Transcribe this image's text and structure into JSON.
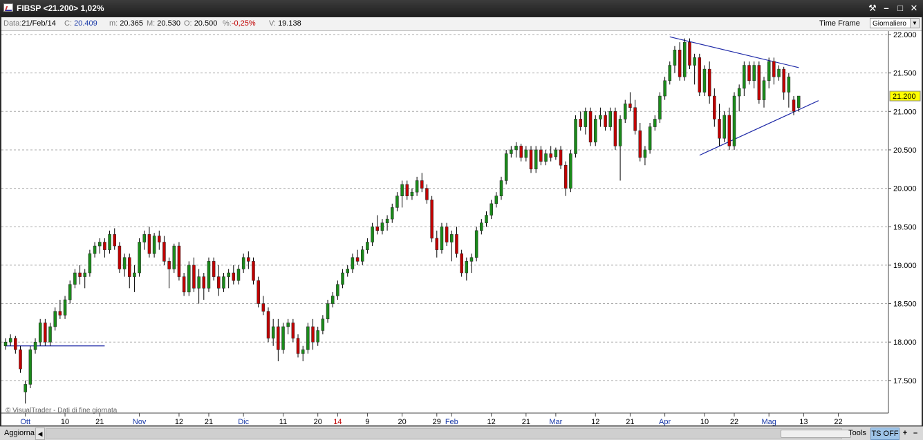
{
  "window": {
    "title": "FIBSP <21.200> 1,02%",
    "controls": [
      "tools-icon",
      "minimize-icon",
      "maximize-icon",
      "close-icon"
    ]
  },
  "info": {
    "data_label": "Data:",
    "data_value": "21/Feb/14",
    "close_label": "C:",
    "close_value": "20.409",
    "min_label": "m:",
    "min_value": "20.365",
    "max_label": "M:",
    "max_value": "20.530",
    "open_label": "O:",
    "open_value": "20.500",
    "pct_label": "%:",
    "pct_value": "-0,25%",
    "vol_label": "V:",
    "vol_value": "19.138",
    "timeframe_label": "Time Frame",
    "timeframe_value": "Giornaliero"
  },
  "colors": {
    "up": "#1a8a1a",
    "down": "#c00000",
    "wick": "#000000",
    "trendline": "#1f2aa8",
    "last_price_bg": "#ffff00",
    "grid": "#aaaaaa"
  },
  "chart_data": {
    "type": "candlestick",
    "symbol": "FIBSP",
    "last_price": "21.200",
    "y_ticks": [
      "22.000",
      "21.500",
      "21.000",
      "20.500",
      "20.000",
      "19.500",
      "19.000",
      "18.500",
      "18.000",
      "17.500"
    ],
    "ylim": [
      17.25,
      22.1
    ],
    "x_ticks": [
      {
        "label": "Ott",
        "i": 4,
        "month": true
      },
      {
        "label": "10",
        "i": 12
      },
      {
        "label": "21",
        "i": 19
      },
      {
        "label": "Nov",
        "i": 27,
        "month": true
      },
      {
        "label": "12",
        "i": 35
      },
      {
        "label": "21",
        "i": 41
      },
      {
        "label": "Dic",
        "i": 48,
        "month": true
      },
      {
        "label": "11",
        "i": 56
      },
      {
        "label": "20",
        "i": 63
      },
      {
        "label": "14",
        "i": 67,
        "red": true
      },
      {
        "label": "9",
        "i": 73
      },
      {
        "label": "20",
        "i": 80
      },
      {
        "label": "29",
        "i": 87
      },
      {
        "label": "Feb",
        "i": 90,
        "month": true
      },
      {
        "label": "12",
        "i": 98
      },
      {
        "label": "21",
        "i": 105
      },
      {
        "label": "Mar",
        "i": 111,
        "month": true
      },
      {
        "label": "12",
        "i": 119
      },
      {
        "label": "21",
        "i": 126
      },
      {
        "label": "Apr",
        "i": 133,
        "month": true
      },
      {
        "label": "10",
        "i": 141
      },
      {
        "label": "22",
        "i": 147
      },
      {
        "label": "Mag",
        "i": 154,
        "month": true
      },
      {
        "label": "13",
        "i": 161
      },
      {
        "label": "22",
        "i": 168
      }
    ],
    "candles": [
      [
        17.95,
        18.05,
        17.9,
        18.0
      ],
      [
        18.0,
        18.1,
        17.95,
        18.05
      ],
      [
        18.05,
        18.08,
        17.85,
        17.9
      ],
      [
        17.9,
        17.95,
        17.6,
        17.65
      ],
      [
        17.35,
        17.5,
        17.2,
        17.45
      ],
      [
        17.45,
        17.95,
        17.4,
        17.9
      ],
      [
        17.9,
        18.05,
        17.85,
        18.0
      ],
      [
        18.0,
        18.3,
        17.95,
        18.25
      ],
      [
        18.25,
        18.3,
        17.95,
        18.0
      ],
      [
        18.0,
        18.25,
        17.95,
        18.2
      ],
      [
        18.2,
        18.45,
        18.15,
        18.4
      ],
      [
        18.4,
        18.55,
        18.3,
        18.35
      ],
      [
        18.35,
        18.6,
        18.3,
        18.55
      ],
      [
        18.55,
        18.8,
        18.5,
        18.75
      ],
      [
        18.75,
        18.95,
        18.7,
        18.9
      ],
      [
        18.9,
        19.0,
        18.75,
        18.85
      ],
      [
        18.85,
        18.95,
        18.7,
        18.9
      ],
      [
        18.9,
        19.2,
        18.85,
        19.15
      ],
      [
        19.15,
        19.3,
        19.1,
        19.25
      ],
      [
        19.25,
        19.35,
        19.15,
        19.3
      ],
      [
        19.3,
        19.35,
        19.1,
        19.2
      ],
      [
        19.2,
        19.45,
        19.15,
        19.4
      ],
      [
        19.4,
        19.48,
        19.2,
        19.25
      ],
      [
        19.25,
        19.3,
        18.9,
        18.95
      ],
      [
        18.95,
        19.15,
        18.85,
        19.1
      ],
      [
        19.1,
        19.15,
        18.7,
        18.85
      ],
      [
        18.85,
        19.0,
        18.65,
        18.9
      ],
      [
        18.9,
        19.35,
        18.85,
        19.3
      ],
      [
        19.3,
        19.45,
        19.2,
        19.4
      ],
      [
        19.4,
        19.5,
        19.1,
        19.15
      ],
      [
        19.15,
        19.42,
        19.1,
        19.38
      ],
      [
        19.38,
        19.45,
        19.2,
        19.3
      ],
      [
        19.3,
        19.38,
        19.0,
        19.05
      ],
      [
        19.05,
        19.1,
        18.7,
        18.95
      ],
      [
        18.95,
        19.28,
        18.9,
        19.25
      ],
      [
        19.25,
        19.3,
        18.8,
        18.85
      ],
      [
        18.85,
        18.9,
        18.6,
        18.65
      ],
      [
        18.65,
        19.05,
        18.6,
        19.0
      ],
      [
        19.0,
        19.1,
        18.65,
        18.7
      ],
      [
        18.7,
        18.95,
        18.5,
        18.85
      ],
      [
        18.85,
        18.9,
        18.55,
        18.7
      ],
      [
        18.7,
        19.1,
        18.65,
        19.05
      ],
      [
        19.05,
        19.1,
        18.8,
        18.85
      ],
      [
        18.85,
        19.0,
        18.6,
        18.7
      ],
      [
        18.7,
        18.9,
        18.65,
        18.85
      ],
      [
        18.85,
        18.95,
        18.7,
        18.9
      ],
      [
        18.9,
        19.0,
        18.75,
        18.8
      ],
      [
        18.8,
        19.0,
        18.75,
        18.95
      ],
      [
        18.95,
        19.15,
        18.9,
        19.1
      ],
      [
        19.1,
        19.18,
        18.95,
        19.05
      ],
      [
        19.05,
        19.1,
        18.75,
        18.8
      ],
      [
        18.8,
        18.85,
        18.45,
        18.5
      ],
      [
        18.5,
        18.6,
        18.35,
        18.4
      ],
      [
        18.4,
        18.45,
        18.0,
        18.05
      ],
      [
        18.05,
        18.3,
        17.95,
        18.2
      ],
      [
        18.2,
        18.3,
        17.75,
        17.9
      ],
      [
        17.9,
        18.25,
        17.85,
        18.2
      ],
      [
        18.2,
        18.3,
        18.1,
        18.25
      ],
      [
        18.25,
        18.3,
        18.0,
        18.05
      ],
      [
        18.05,
        18.1,
        17.8,
        17.85
      ],
      [
        17.85,
        17.95,
        17.75,
        17.9
      ],
      [
        17.9,
        18.25,
        17.85,
        18.2
      ],
      [
        18.2,
        18.3,
        17.9,
        18.0
      ],
      [
        18.0,
        18.2,
        17.95,
        18.15
      ],
      [
        18.15,
        18.35,
        18.1,
        18.3
      ],
      [
        18.3,
        18.55,
        18.25,
        18.5
      ],
      [
        18.5,
        18.65,
        18.45,
        18.6
      ],
      [
        18.6,
        18.8,
        18.55,
        18.75
      ],
      [
        18.75,
        18.95,
        18.7,
        18.9
      ],
      [
        18.9,
        19.0,
        18.85,
        18.95
      ],
      [
        18.95,
        19.15,
        18.9,
        19.1
      ],
      [
        19.1,
        19.2,
        19.0,
        19.05
      ],
      [
        19.05,
        19.25,
        19.0,
        19.2
      ],
      [
        19.2,
        19.35,
        19.15,
        19.3
      ],
      [
        19.3,
        19.55,
        19.25,
        19.5
      ],
      [
        19.5,
        19.65,
        19.4,
        19.45
      ],
      [
        19.45,
        19.6,
        19.4,
        19.55
      ],
      [
        19.55,
        19.65,
        19.45,
        19.6
      ],
      [
        19.6,
        19.8,
        19.55,
        19.75
      ],
      [
        19.75,
        19.95,
        19.7,
        19.9
      ],
      [
        19.9,
        20.1,
        19.75,
        20.05
      ],
      [
        20.05,
        20.1,
        19.85,
        19.9
      ],
      [
        19.9,
        20.0,
        19.85,
        19.95
      ],
      [
        19.95,
        20.15,
        19.9,
        20.1
      ],
      [
        20.1,
        20.2,
        19.95,
        20.0
      ],
      [
        20.0,
        20.05,
        19.8,
        19.85
      ],
      [
        19.85,
        19.9,
        19.3,
        19.35
      ],
      [
        19.35,
        19.45,
        19.1,
        19.2
      ],
      [
        19.2,
        19.55,
        19.15,
        19.5
      ],
      [
        19.5,
        19.55,
        19.25,
        19.3
      ],
      [
        19.3,
        19.45,
        19.05,
        19.4
      ],
      [
        19.4,
        19.5,
        19.1,
        19.15
      ],
      [
        19.15,
        19.2,
        18.85,
        18.9
      ],
      [
        18.9,
        19.1,
        18.8,
        19.05
      ],
      [
        19.05,
        19.15,
        18.9,
        19.1
      ],
      [
        19.1,
        19.5,
        19.05,
        19.45
      ],
      [
        19.45,
        19.6,
        19.4,
        19.55
      ],
      [
        19.55,
        19.7,
        19.5,
        19.65
      ],
      [
        19.65,
        19.85,
        19.6,
        19.8
      ],
      [
        19.8,
        19.95,
        19.75,
        19.9
      ],
      [
        19.9,
        20.15,
        19.85,
        20.1
      ],
      [
        20.1,
        20.5,
        20.05,
        20.45
      ],
      [
        20.45,
        20.55,
        20.4,
        20.5
      ],
      [
        20.5,
        20.6,
        20.4,
        20.55
      ],
      [
        20.55,
        20.58,
        20.35,
        20.4
      ],
      [
        20.4,
        20.55,
        20.35,
        20.5
      ],
      [
        20.5,
        20.55,
        20.2,
        20.25
      ],
      [
        20.25,
        20.55,
        20.2,
        20.5
      ],
      [
        20.5,
        20.55,
        20.3,
        20.35
      ],
      [
        20.35,
        20.5,
        20.3,
        20.45
      ],
      [
        20.45,
        20.55,
        20.35,
        20.4
      ],
      [
        20.41,
        20.53,
        20.37,
        20.5
      ],
      [
        20.5,
        20.55,
        20.25,
        20.3
      ],
      [
        20.3,
        20.35,
        19.9,
        20.0
      ],
      [
        20.0,
        20.5,
        19.95,
        20.45
      ],
      [
        20.45,
        20.95,
        20.4,
        20.9
      ],
      [
        20.9,
        21.0,
        20.75,
        20.8
      ],
      [
        20.8,
        21.05,
        20.7,
        21.0
      ],
      [
        21.0,
        21.05,
        20.55,
        20.6
      ],
      [
        20.6,
        20.95,
        20.55,
        20.9
      ],
      [
        20.9,
        21.05,
        20.8,
        20.95
      ],
      [
        20.95,
        21.0,
        20.75,
        20.8
      ],
      [
        20.8,
        21.05,
        20.75,
        21.0
      ],
      [
        21.0,
        21.05,
        20.5,
        20.55
      ],
      [
        20.55,
        20.95,
        20.1,
        20.9
      ],
      [
        20.9,
        21.15,
        20.85,
        21.1
      ],
      [
        21.1,
        21.25,
        21.0,
        21.05
      ],
      [
        21.05,
        21.15,
        20.7,
        20.75
      ],
      [
        20.75,
        20.85,
        20.35,
        20.4
      ],
      [
        20.4,
        20.55,
        20.3,
        20.5
      ],
      [
        20.5,
        20.85,
        20.45,
        20.8
      ],
      [
        20.8,
        20.95,
        20.75,
        20.9
      ],
      [
        20.9,
        21.25,
        20.85,
        21.2
      ],
      [
        21.2,
        21.45,
        21.15,
        21.4
      ],
      [
        21.4,
        21.65,
        21.35,
        21.6
      ],
      [
        21.6,
        21.85,
        21.5,
        21.8
      ],
      [
        21.8,
        21.9,
        21.4,
        21.45
      ],
      [
        21.45,
        21.95,
        21.4,
        21.9
      ],
      [
        21.9,
        21.95,
        21.55,
        21.6
      ],
      [
        21.6,
        21.75,
        21.35,
        21.7
      ],
      [
        21.7,
        21.75,
        21.2,
        21.25
      ],
      [
        21.25,
        21.6,
        21.2,
        21.55
      ],
      [
        21.55,
        21.65,
        21.1,
        21.2
      ],
      [
        21.2,
        21.3,
        20.8,
        20.9
      ],
      [
        20.9,
        21.1,
        20.55,
        20.65
      ],
      [
        20.65,
        21.0,
        20.6,
        20.95
      ],
      [
        20.95,
        21.05,
        20.5,
        20.55
      ],
      [
        20.55,
        21.25,
        20.5,
        21.2
      ],
      [
        21.2,
        21.35,
        21.0,
        21.3
      ],
      [
        21.3,
        21.65,
        21.2,
        21.6
      ],
      [
        21.6,
        21.65,
        21.35,
        21.4
      ],
      [
        21.4,
        21.65,
        21.3,
        21.6
      ],
      [
        21.6,
        21.65,
        21.1,
        21.15
      ],
      [
        21.15,
        21.45,
        21.05,
        21.4
      ],
      [
        21.4,
        21.7,
        21.3,
        21.65
      ],
      [
        21.65,
        21.7,
        21.35,
        21.45
      ],
      [
        21.45,
        21.6,
        21.4,
        21.55
      ],
      [
        21.55,
        21.58,
        21.15,
        21.25
      ],
      [
        21.25,
        21.5,
        21.05,
        21.45
      ],
      [
        21.15,
        21.2,
        20.95,
        21.0
      ],
      [
        21.05,
        21.2,
        21.0,
        21.2
      ]
    ],
    "trendlines": [
      {
        "i1": 0,
        "v1": 17.95,
        "i2": 20,
        "v2": 17.95
      },
      {
        "i1": 134,
        "v1": 21.97,
        "i2": 160,
        "v2": 21.57
      },
      {
        "i1": 140,
        "v1": 20.43,
        "i2": 164,
        "v2": 21.14
      }
    ]
  },
  "footer": {
    "watermark": "© VisualTrader - Dati di fine giornata",
    "aggiorna": "Aggiorna",
    "tools": "Tools",
    "ts_off": "TS OFF",
    "plus": "+",
    "minus": "–"
  }
}
